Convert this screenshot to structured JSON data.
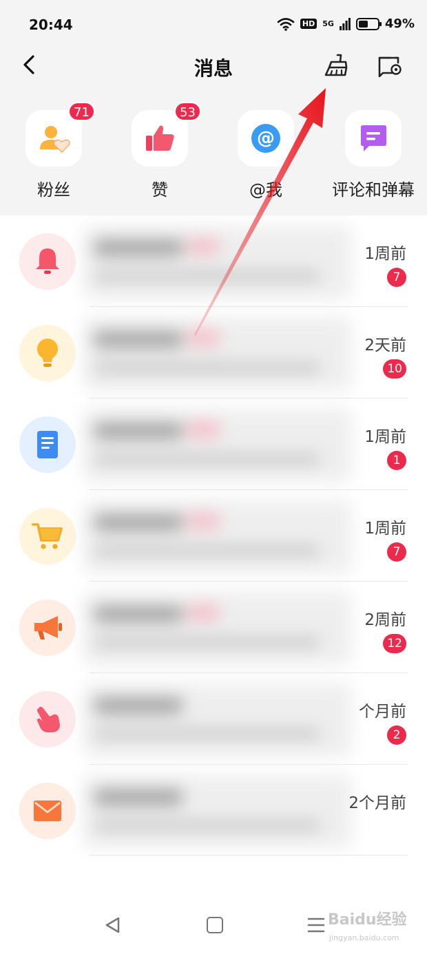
{
  "status_bar": {
    "time": "20:44",
    "hd": "HD",
    "network": "5G",
    "battery": "49%",
    "battery_level": 0.49
  },
  "header": {
    "title": "消息",
    "back_icon": "chevron-left-icon",
    "clean_icon": "broom-icon",
    "settings_icon": "message-settings-icon"
  },
  "categories": [
    {
      "label": "粉丝",
      "icon": "fans-icon",
      "badge": "71"
    },
    {
      "label": "赞",
      "icon": "thumbs-up-icon",
      "badge": "53"
    },
    {
      "label": "@我",
      "icon": "at-icon",
      "badge": ""
    },
    {
      "label": "评论和弹幕",
      "icon": "comment-icon",
      "badge": ""
    }
  ],
  "messages": [
    {
      "icon": "bell-icon",
      "time": "1周前",
      "badge": "7"
    },
    {
      "icon": "lightbulb-icon",
      "time": "2天前",
      "badge": "10"
    },
    {
      "icon": "document-icon",
      "time": "1周前",
      "badge": "1"
    },
    {
      "icon": "shopping-cart-icon",
      "time": "1周前",
      "badge": "7"
    },
    {
      "icon": "megaphone-icon",
      "time": "2周前",
      "badge": "12"
    },
    {
      "icon": "pointing-hand-icon",
      "time": "个月前",
      "badge": "2"
    },
    {
      "icon": "envelope-icon",
      "time": "2个月前",
      "badge": ""
    }
  ],
  "watermark": {
    "text": "Baidu经验",
    "sub": "jingyan.baidu.com"
  },
  "colors": {
    "accent_red": "#ec2a4c",
    "annotation_arrow": "#e8141c",
    "header_background": "#f4f4f4"
  }
}
